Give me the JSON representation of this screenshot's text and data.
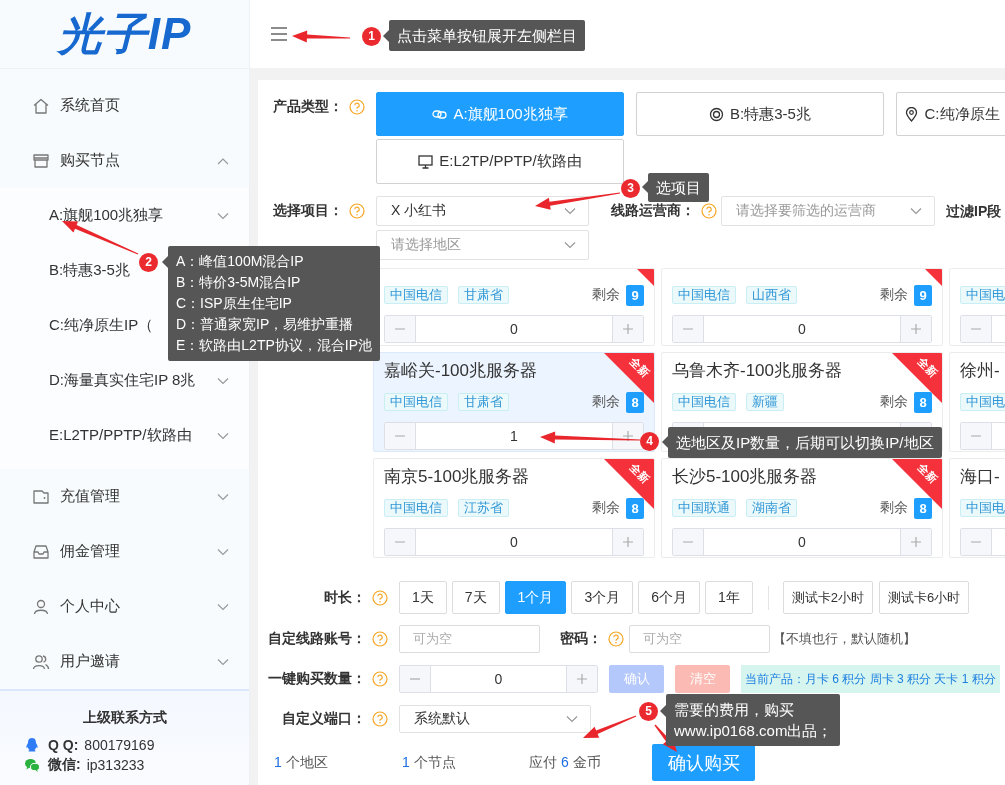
{
  "sidebar": {
    "logo": "光子IP",
    "items": [
      {
        "label": "系统首页",
        "kind": "link"
      },
      {
        "label": "购买节点",
        "kind": "group",
        "expanded": true,
        "children": [
          {
            "label": "A:旗舰100兆独享",
            "expanded": false
          },
          {
            "label": "B:特惠3-5兆"
          },
          {
            "label": "C:纯净原生IP（"
          },
          {
            "label": "D:海量真实住宅IP 8兆",
            "expanded": false
          },
          {
            "label": "E:L2TP/PPTP/软路由",
            "expanded": false
          }
        ]
      },
      {
        "label": "充值管理",
        "kind": "group",
        "expanded": false
      },
      {
        "label": "佣金管理",
        "kind": "group",
        "expanded": false
      },
      {
        "label": "个人中心",
        "kind": "group",
        "expanded": false
      },
      {
        "label": "用户邀请",
        "kind": "group",
        "expanded": false
      }
    ],
    "contact": {
      "title": "上级联系方式",
      "rows": [
        {
          "label": "Q Q:",
          "value": "800179169"
        },
        {
          "label": "微信:",
          "value": "ip313233"
        }
      ]
    }
  },
  "product_type": {
    "label": "产品类型：",
    "options": [
      {
        "label": "A:旗舰100兆独享",
        "selected": true
      },
      {
        "label": "B:特惠3-5兆",
        "selected": false
      },
      {
        "label": "C:纯净原生",
        "selected": false
      },
      {
        "label": "E:L2TP/PPTP/软路由",
        "selected": false
      }
    ]
  },
  "project": {
    "label": "选择项目：",
    "value": "X 小红书",
    "region_placeholder": "请选择地区"
  },
  "carrier": {
    "label": "线路运营商：",
    "placeholder": "请选择要筛选的运营商"
  },
  "ip_filter": {
    "label": "过滤IP段"
  },
  "nodes": {
    "cards": [
      {
        "tags": [
          "中国电信",
          "甘肃省"
        ],
        "remaining_label": "剩余",
        "remaining": "9",
        "quantity": "0",
        "new": true,
        "selected": false
      },
      {
        "tags": [
          "中国电信",
          "山西省"
        ],
        "remaining_label": "剩余",
        "remaining": "9",
        "quantity": "0",
        "new": true,
        "selected": false
      },
      {
        "tags": [
          "中国电"
        ],
        "selected": false
      },
      {
        "title": "嘉峪关-100兆服务器",
        "tags": [
          "中国电信",
          "甘肃省"
        ],
        "remaining_label": "剩余",
        "remaining": "8",
        "quantity": "1",
        "new": true,
        "badge": "全新",
        "selected": true
      },
      {
        "title": "乌鲁木齐-100兆服务器",
        "tags": [
          "中国电信",
          "新疆"
        ],
        "remaining_label": "剩余",
        "remaining": "8",
        "new": true,
        "badge": "全新",
        "selected": false
      },
      {
        "title": "徐州-",
        "tags": [
          "中国电"
        ],
        "selected": false
      },
      {
        "title": "南京5-100兆服务器",
        "tags": [
          "中国电信",
          "江苏省"
        ],
        "remaining_label": "剩余",
        "remaining": "8",
        "quantity": "0",
        "new": true,
        "badge": "全新",
        "selected": false
      },
      {
        "title": "长沙5-100兆服务器",
        "tags": [
          "中国联通",
          "湖南省"
        ],
        "remaining_label": "剩余",
        "remaining": "8",
        "quantity": "0",
        "new": true,
        "badge": "全新",
        "selected": false
      },
      {
        "title": "海口-",
        "tags": [
          "中国电"
        ],
        "selected": false
      }
    ]
  },
  "duration": {
    "label": "时长：",
    "options": [
      {
        "label": "1天",
        "selected": false
      },
      {
        "label": "7天",
        "selected": false
      },
      {
        "label": "1个月",
        "selected": true
      },
      {
        "label": "3个月",
        "selected": false
      },
      {
        "label": "6个月",
        "selected": false
      },
      {
        "label": "1年",
        "selected": false
      }
    ],
    "trial_options": [
      {
        "label": "测试卡2小时",
        "selected": false
      },
      {
        "label": "测试卡6小时",
        "selected": false
      }
    ]
  },
  "account": {
    "label": "自定线路账号：",
    "placeholder": "可为空"
  },
  "password": {
    "label": "密码：",
    "placeholder": "可为空",
    "note": "【不填也行，默认随机】"
  },
  "bulk": {
    "label": "一键购买数量：",
    "quantity": "0",
    "confirm": {
      "label": "确认",
      "disabled": true
    },
    "clear": {
      "label": "清空",
      "disabled": true
    },
    "info": "当前产品：月卡 6 积分 周卡 3 积分 天卡 1 积分"
  },
  "port": {
    "label": "自定义端口：",
    "value": "系统默认"
  },
  "summary": [
    {
      "value": "1",
      "unit": "个地区"
    },
    {
      "value": "1",
      "unit": "个节点"
    },
    {
      "prefix": "应付",
      "value": "6",
      "unit": "金币"
    }
  ],
  "submit": "确认购买",
  "annotations": [
    {
      "number": "1",
      "lines": [
        "点击菜单按钮展开左侧栏目"
      ]
    },
    {
      "number": "2",
      "lines": [
        "A：峰值100M混合IP",
        "B：特价3-5M混合IP",
        "C：ISP原生住宅IP",
        "D：普通家宽IP，易维护重播",
        "E：软路由L2TP协议，混合IP池"
      ]
    },
    {
      "number": "3",
      "lines": [
        "选项目"
      ]
    },
    {
      "number": "4",
      "lines": [
        "选地区及IP数量，后期可以切换IP/地区"
      ]
    },
    {
      "number": "5",
      "lines": [
        "需要的费用，购买",
        "www.ip0168.com出品；"
      ]
    }
  ]
}
